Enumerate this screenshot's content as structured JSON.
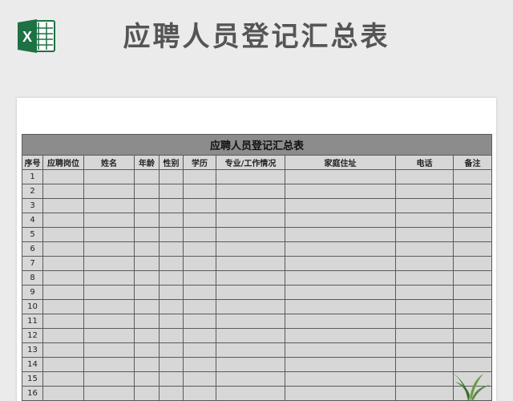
{
  "header": {
    "title": "应聘人员登记汇总表",
    "logo_icon": "excel-icon",
    "logo_letter": "X",
    "logo_color": "#1e7145"
  },
  "table": {
    "title": "应聘人员登记汇总表",
    "columns": [
      "序号",
      "应聘岗位",
      "姓名",
      "年龄",
      "性别",
      "学历",
      "专业/工作情况",
      "家庭住址",
      "电话",
      "备注"
    ],
    "rows": [
      "1",
      "2",
      "3",
      "4",
      "5",
      "6",
      "7",
      "8",
      "9",
      "10",
      "11",
      "12",
      "13",
      "14",
      "15",
      "16"
    ]
  },
  "colors": {
    "title_bar": "#8c8c8c",
    "cell_bg": "#d7d7d7",
    "page_bg": "#ebebeb"
  },
  "decorations": {
    "plant_icon": "potted-plant-icon"
  }
}
